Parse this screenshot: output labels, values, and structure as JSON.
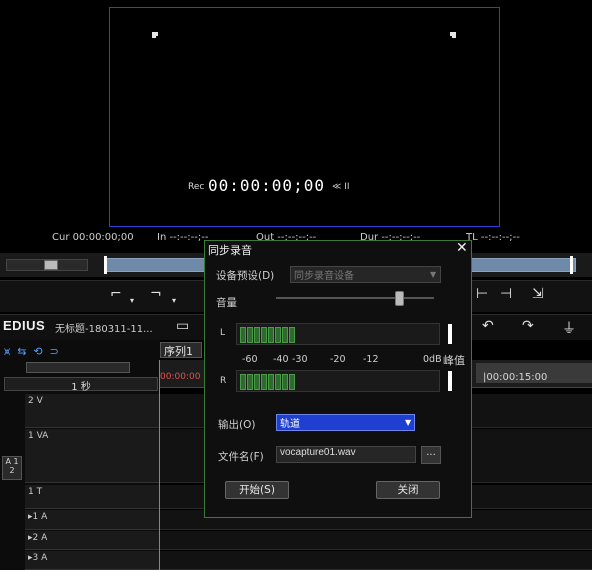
{
  "preview": {
    "rec_label": "Rec",
    "timecode": "00:00:00;00",
    "timecode_suffix": "≪ II",
    "cur_label": "Cur 00:00:00;00",
    "in_label": "In --:--:--;--",
    "out_label": "Out --:--:--;--",
    "dur_label": "Dur --:--:--;--",
    "ttl_label": "TL --:--:--;--"
  },
  "app": {
    "logo": "EDIUS",
    "project_title": "无标题-180311-11..."
  },
  "timeline": {
    "sequence_tab": "序列1",
    "zoom_label": "1 秒",
    "ruler_left": "00:00:00",
    "ruler_right": "|00:00:15:00",
    "tracks": [
      {
        "name": "2 V"
      },
      {
        "name": "1 VA"
      },
      {
        "name": "1 T"
      },
      {
        "name": "▸1 A"
      },
      {
        "name": "▸2 A"
      },
      {
        "name": "▸3 A"
      }
    ],
    "track_group_label": "A 1 2"
  },
  "dialog": {
    "title": "同步录音",
    "close_icon": "close-icon",
    "preset_label": "设备预设(D)",
    "preset_value": "同步录音设备",
    "volume_label": "音量",
    "volume_level": 0.8,
    "meter_left_label": "L",
    "meter_right_label": "R",
    "scale": [
      "-60",
      "-40",
      "-30",
      "-20",
      "-12",
      "0dB",
      "峰值"
    ],
    "output_label": "输出(O)",
    "output_value": "轨道",
    "filename_label": "文件名(F)",
    "filename_value": "vocapture01.wav",
    "browse_label": "...",
    "start_button": "开始(S)",
    "close_button": "关闭"
  }
}
